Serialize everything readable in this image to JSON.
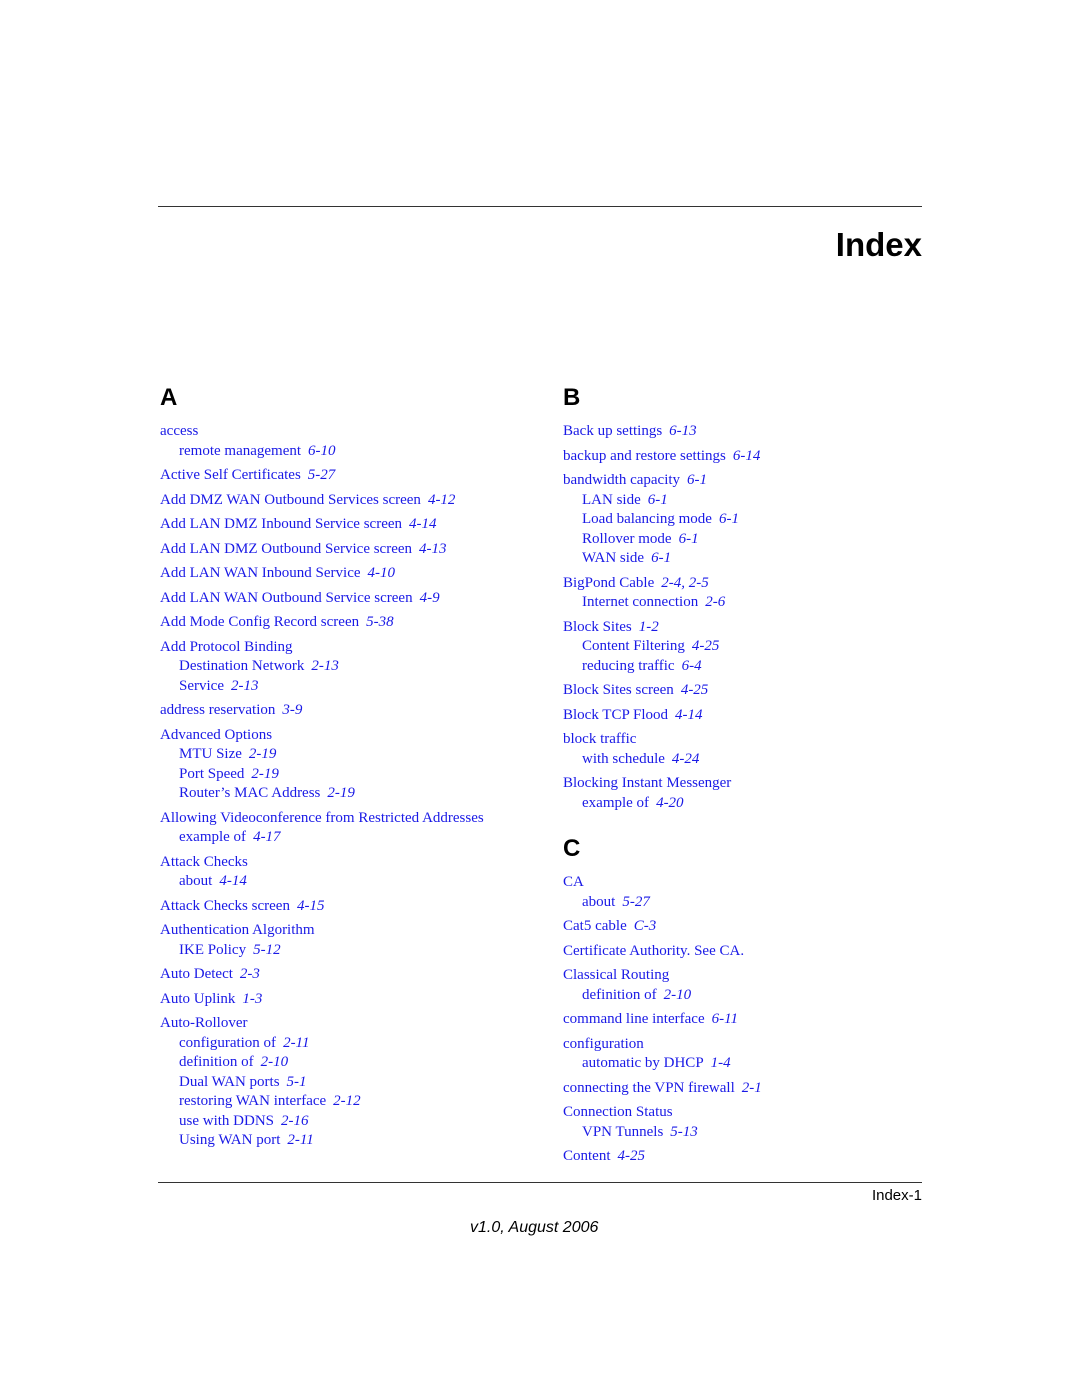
{
  "page": {
    "title": "Index",
    "page_number": "Index-1",
    "footer": "v1.0, August 2006"
  },
  "sections": {
    "A": {
      "letter": "A",
      "groups": [
        {
          "term": "access",
          "pages": "",
          "subs": [
            {
              "term": "remote management",
              "pages": "6-10"
            }
          ]
        },
        {
          "term": "Active Self Certificates",
          "pages": "5-27",
          "subs": []
        },
        {
          "term": "Add DMZ WAN Outbound Services screen",
          "pages": "4-12",
          "subs": []
        },
        {
          "term": "Add LAN DMZ Inbound Service screen",
          "pages": "4-14",
          "subs": []
        },
        {
          "term": "Add LAN DMZ Outbound Service screen",
          "pages": "4-13",
          "subs": []
        },
        {
          "term": "Add LAN WAN Inbound Service",
          "pages": "4-10",
          "subs": []
        },
        {
          "term": "Add LAN WAN Outbound Service screen",
          "pages": "4-9",
          "subs": []
        },
        {
          "term": "Add Mode Config Record screen",
          "pages": "5-38",
          "subs": []
        },
        {
          "term": "Add Protocol Binding",
          "pages": "",
          "subs": [
            {
              "term": "Destination Network",
              "pages": "2-13"
            },
            {
              "term": "Service",
              "pages": "2-13"
            }
          ]
        },
        {
          "term": "address reservation",
          "pages": "3-9",
          "subs": []
        },
        {
          "term": "Advanced Options",
          "pages": "",
          "subs": [
            {
              "term": "MTU Size",
              "pages": "2-19"
            },
            {
              "term": "Port Speed",
              "pages": "2-19"
            },
            {
              "term": "Router’s MAC Address",
              "pages": "2-19"
            }
          ]
        },
        {
          "term": "Allowing Videoconference from Restricted Addresses",
          "pages": "",
          "subs": [
            {
              "term": "example of",
              "pages": "4-17"
            }
          ]
        },
        {
          "term": "Attack Checks",
          "pages": "",
          "subs": [
            {
              "term": "about",
              "pages": "4-14"
            }
          ]
        },
        {
          "term": "Attack Checks screen",
          "pages": "4-15",
          "subs": []
        },
        {
          "term": "Authentication Algorithm",
          "pages": "",
          "subs": [
            {
              "term": "IKE Policy",
              "pages": "5-12"
            }
          ]
        },
        {
          "term": "Auto Detect",
          "pages": "2-3",
          "subs": []
        },
        {
          "term": "Auto Uplink",
          "pages": "1-3",
          "subs": []
        },
        {
          "term": "Auto-Rollover",
          "pages": "",
          "subs": [
            {
              "term": "configuration of",
              "pages": "2-11"
            },
            {
              "term": "definition of",
              "pages": "2-10"
            },
            {
              "term": "Dual WAN ports",
              "pages": "5-1"
            },
            {
              "term": "restoring WAN interface",
              "pages": "2-12"
            },
            {
              "term": "use with DDNS",
              "pages": "2-16"
            },
            {
              "term": "Using WAN port",
              "pages": "2-11"
            }
          ]
        }
      ]
    },
    "B": {
      "letter": "B",
      "groups": [
        {
          "term": "Back up settings",
          "pages": "6-13",
          "subs": []
        },
        {
          "term": "backup and restore settings",
          "pages": "6-14",
          "subs": []
        },
        {
          "term": "bandwidth capacity",
          "pages": "6-1",
          "subs": [
            {
              "term": "LAN side",
              "pages": "6-1"
            },
            {
              "term": "Load balancing mode",
              "pages": "6-1"
            },
            {
              "term": "Rollover mode",
              "pages": "6-1"
            },
            {
              "term": "WAN side",
              "pages": "6-1"
            }
          ]
        },
        {
          "term": "BigPond Cable",
          "pages": "2-4, 2-5",
          "subs": [
            {
              "term": "Internet connection",
              "pages": "2-6"
            }
          ]
        },
        {
          "term": "Block Sites",
          "pages": "1-2",
          "subs": [
            {
              "term": "Content Filtering",
              "pages": "4-25"
            },
            {
              "term": "reducing traffic",
              "pages": "6-4"
            }
          ]
        },
        {
          "term": "Block Sites screen",
          "pages": "4-25",
          "subs": []
        },
        {
          "term": "Block TCP Flood",
          "pages": "4-14",
          "subs": []
        },
        {
          "term": "block traffic",
          "pages": "",
          "subs": [
            {
              "term": "with schedule",
              "pages": "4-24"
            }
          ]
        },
        {
          "term": "Blocking Instant Messenger",
          "pages": "",
          "subs": [
            {
              "term": "example of",
              "pages": "4-20"
            }
          ]
        }
      ]
    },
    "C": {
      "letter": "C",
      "groups": [
        {
          "term": "CA",
          "pages": "",
          "subs": [
            {
              "term": "about",
              "pages": "5-27"
            }
          ]
        },
        {
          "term": "Cat5 cable",
          "pages": "C-3",
          "subs": []
        },
        {
          "term": "Certificate Authority. See CA.",
          "pages": "",
          "subs": []
        },
        {
          "term": "Classical Routing",
          "pages": "",
          "subs": [
            {
              "term": "definition of",
              "pages": "2-10"
            }
          ]
        },
        {
          "term": "command line interface",
          "pages": "6-11",
          "subs": []
        },
        {
          "term": "configuration",
          "pages": "",
          "subs": [
            {
              "term": "automatic by DHCP",
              "pages": "1-4"
            }
          ]
        },
        {
          "term": "connecting the VPN firewall",
          "pages": "2-1",
          "subs": []
        },
        {
          "term": "Connection Status",
          "pages": "",
          "subs": [
            {
              "term": "VPN Tunnels",
              "pages": "5-13"
            }
          ]
        },
        {
          "term": "Content",
          "pages": "4-25",
          "subs": []
        }
      ]
    }
  }
}
